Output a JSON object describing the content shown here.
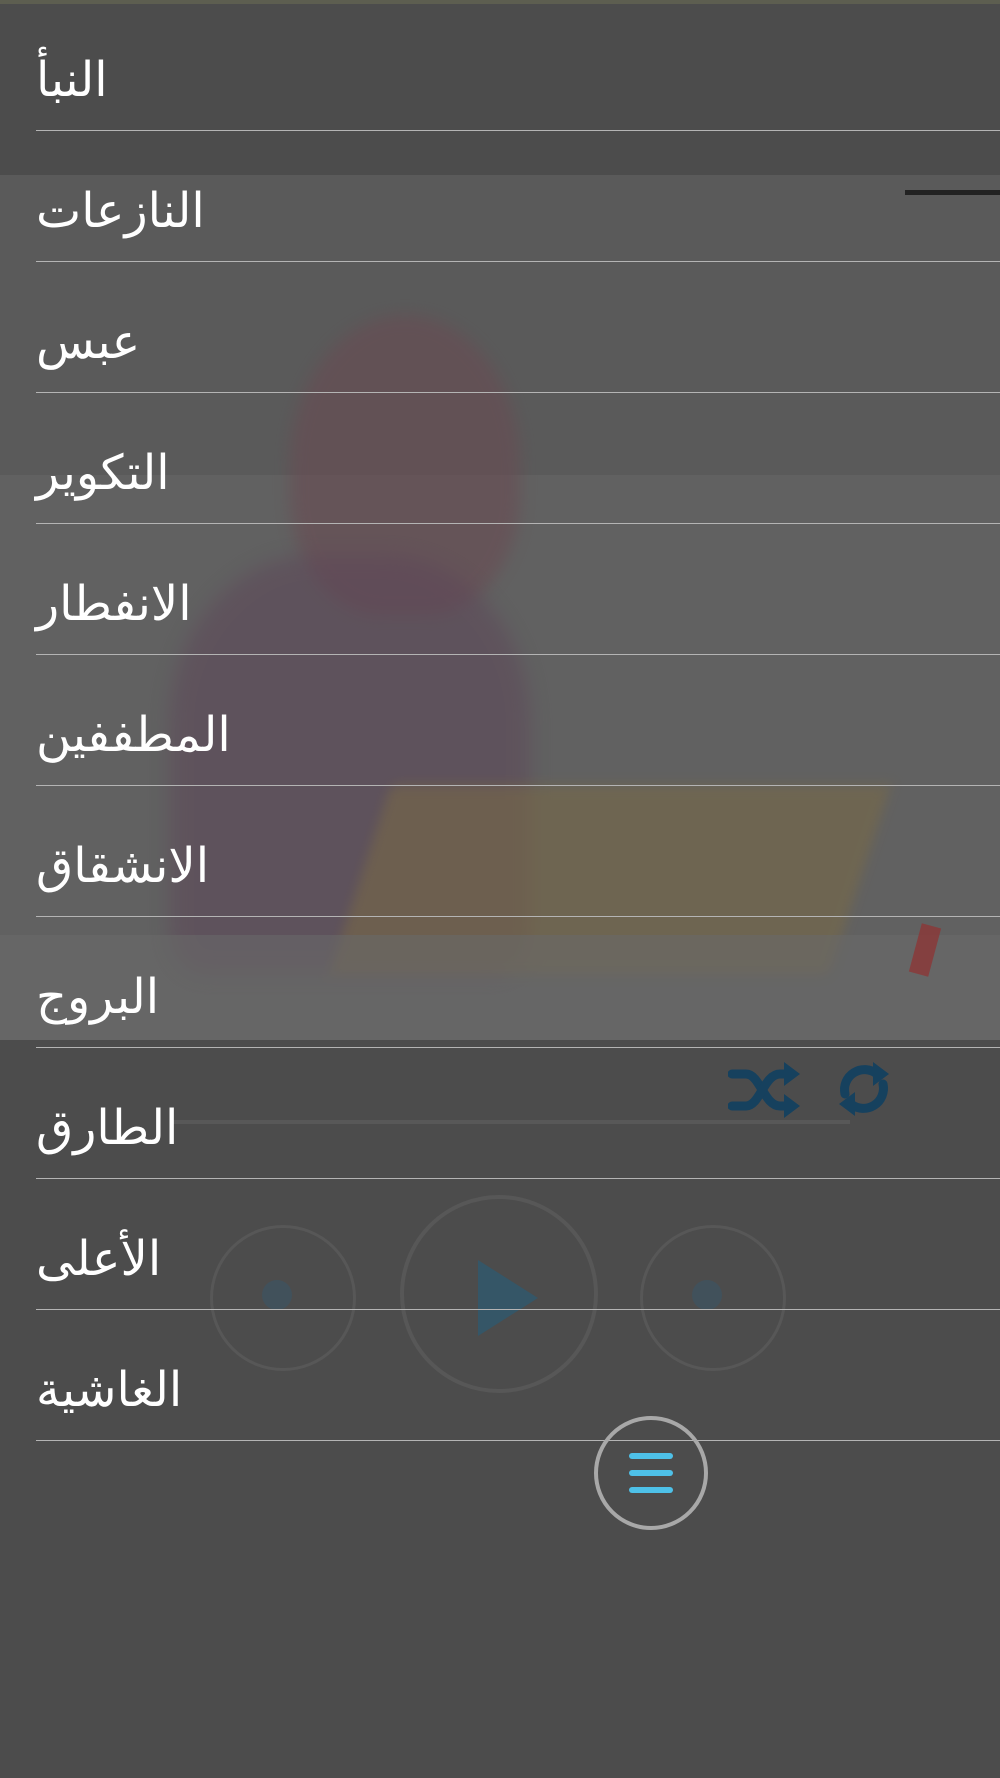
{
  "menu": {
    "items": [
      {
        "label": "النبأ"
      },
      {
        "label": "النازعات"
      },
      {
        "label": "عبس"
      },
      {
        "label": "التكوير"
      },
      {
        "label": "الانفطار"
      },
      {
        "label": "المطففين"
      },
      {
        "label": "الانشقاق"
      },
      {
        "label": "البروج"
      },
      {
        "label": "الطارق"
      },
      {
        "label": "الأعلى"
      },
      {
        "label": "الغاشية"
      }
    ]
  },
  "player": {
    "icons": [
      "shuffle-icon",
      "repeat-icon",
      "previous-icon",
      "play-icon",
      "next-icon"
    ],
    "accent_color": "#4ec1e8",
    "icon_color": "#16415e"
  },
  "fab": {
    "icon": "hamburger-menu-icon"
  }
}
